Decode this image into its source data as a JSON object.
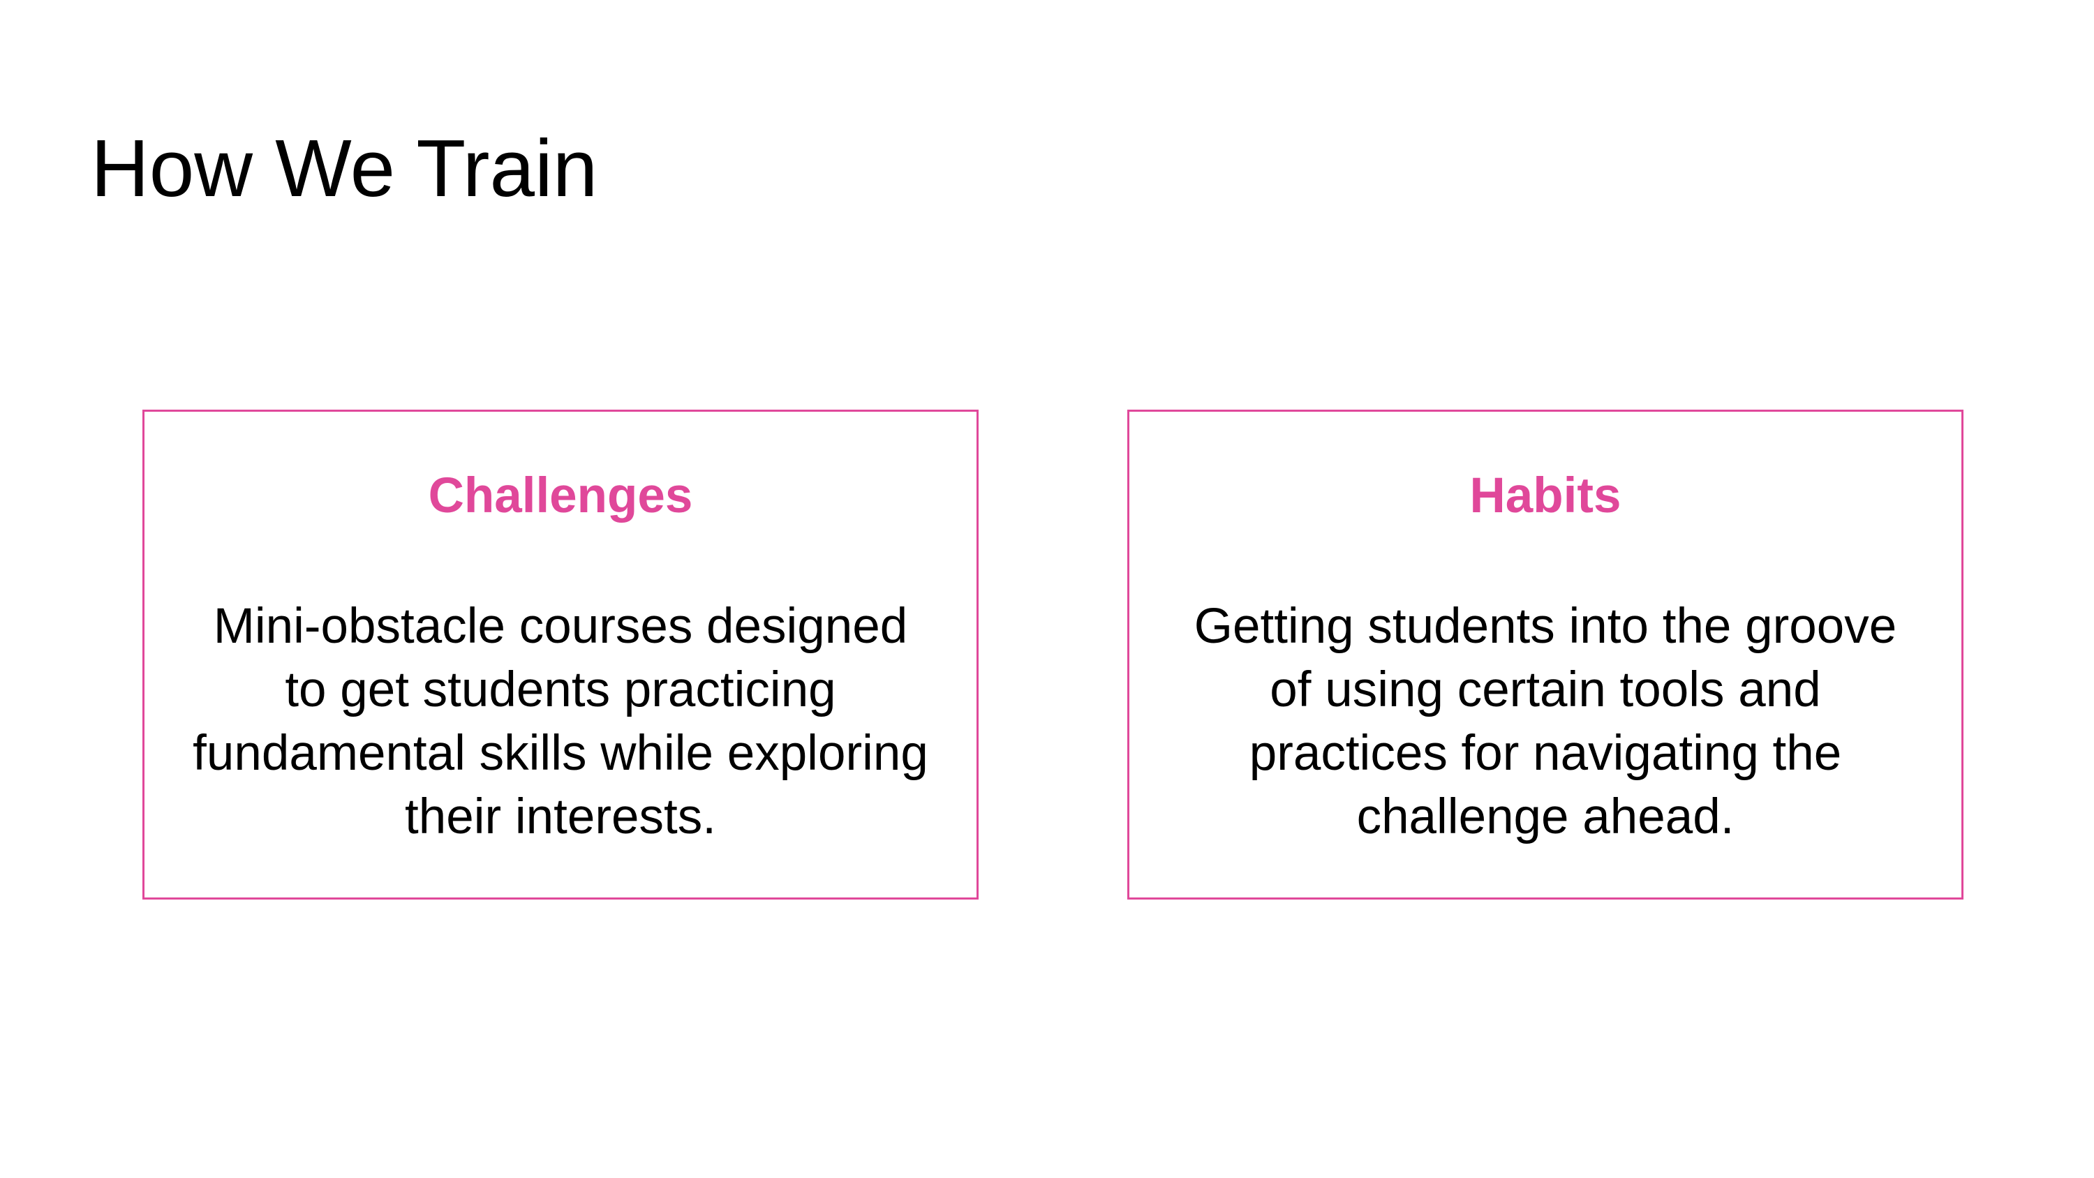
{
  "slide": {
    "title": "How We Train",
    "accent_color": "#e0489a"
  },
  "cards": [
    {
      "heading": "Challenges",
      "body_lines": [
        "Mini-obstacle courses designed",
        "to get students practicing",
        "fundamental skills while exploring",
        "their interests."
      ]
    },
    {
      "heading": "Habits",
      "body_lines": [
        "Getting students into the groove",
        "of using certain tools and",
        "practices for navigating the",
        "challenge ahead."
      ]
    }
  ]
}
